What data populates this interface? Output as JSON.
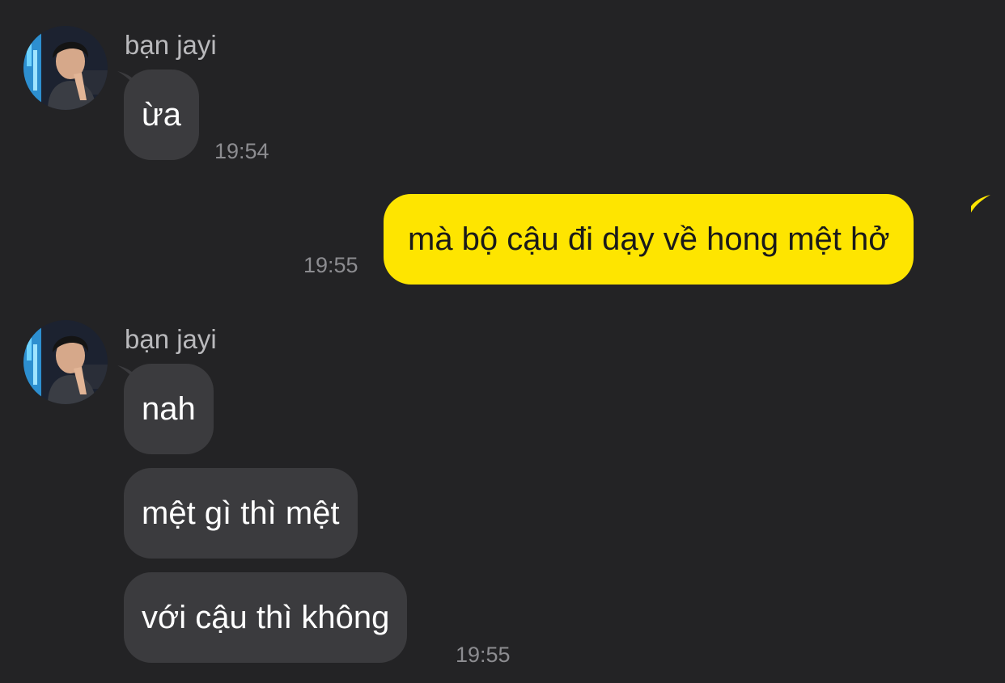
{
  "colors": {
    "background": "#232325",
    "incoming_bubble": "#3b3b3e",
    "outgoing_bubble": "#fee500",
    "incoming_text": "#ffffff",
    "outgoing_text": "#1a1a1a",
    "sender_name": "#b9b9bc",
    "timestamp": "#8c8c90"
  },
  "groups": [
    {
      "direction": "incoming",
      "sender": "bạn jayi",
      "avatar_icon": "user-photo-avatar",
      "messages": [
        "ừa"
      ],
      "time": "19:54"
    },
    {
      "direction": "outgoing",
      "messages": [
        "mà bộ cậu đi dạy về hong mệt hở"
      ],
      "time": "19:55"
    },
    {
      "direction": "incoming",
      "sender": "bạn jayi",
      "avatar_icon": "user-photo-avatar",
      "messages": [
        "nah",
        "mệt gì thì mệt",
        "với cậu thì không"
      ],
      "time": "19:55"
    }
  ]
}
